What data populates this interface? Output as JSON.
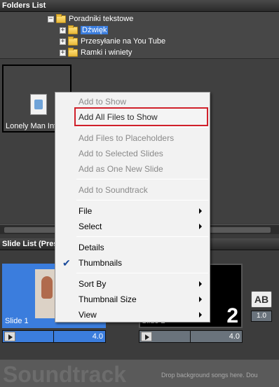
{
  "folders": {
    "header": "Folders List",
    "tree": [
      {
        "box": "−",
        "label": "Poradniki tekstowe"
      },
      {
        "box": "+",
        "label": "Dźwięk"
      },
      {
        "box": "+",
        "label": "Przesyłanie na You Tube"
      },
      {
        "box": "+",
        "label": "Ramki i winiety"
      }
    ]
  },
  "files": {
    "tile_name": "Lonely Man Int"
  },
  "slides": {
    "header": "Slide List (Pres",
    "items": [
      {
        "name": "Slide 1",
        "number": "1",
        "duration": "4.0"
      },
      {
        "name": "Slide 2",
        "number": "2",
        "duration": "4.0"
      }
    ],
    "transition_icon": "AB",
    "transition_duration": "1.0"
  },
  "soundtrack": {
    "title": "Soundtrack",
    "hint": "Drop background songs here.  Dou"
  },
  "context_menu": {
    "items": [
      {
        "label": "Add to Show"
      },
      {
        "label": "Add All Files to Show"
      },
      {
        "label": "Add Files to Placeholders"
      },
      {
        "label": "Add to Selected Slides"
      },
      {
        "label": "Add as One New Slide"
      },
      {
        "label": "Add to Soundtrack"
      },
      {
        "label": "File"
      },
      {
        "label": "Select"
      },
      {
        "label": "Details"
      },
      {
        "label": "Thumbnails",
        "checked": "✔"
      },
      {
        "label": "Sort By"
      },
      {
        "label": "Thumbnail Size"
      },
      {
        "label": "View"
      }
    ]
  },
  "colors": {
    "selection_blue": "#3b7ddd",
    "highlight_red": "#d0202a"
  }
}
